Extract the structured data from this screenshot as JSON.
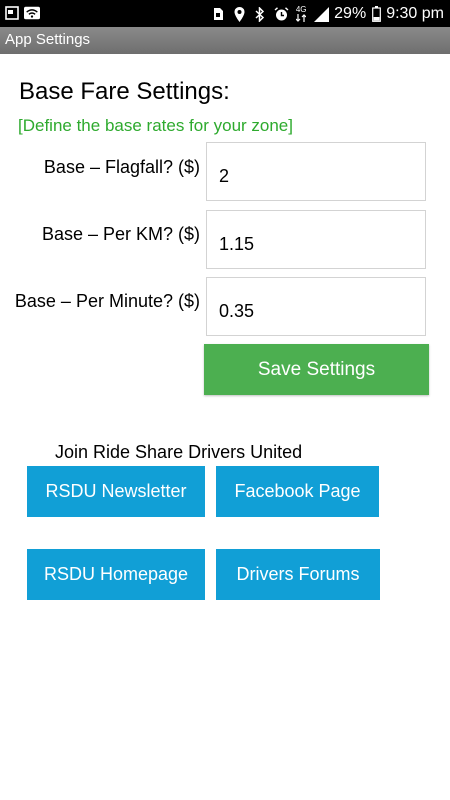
{
  "status_bar": {
    "battery_percent": "29%",
    "time": "9:30 pm",
    "network_label": "4G",
    "icons": [
      "screenshot-icon",
      "wifi-icon",
      "sim-icon",
      "location-icon",
      "bluetooth-icon",
      "alarm-icon",
      "network-icon",
      "signal-icon",
      "battery-icon"
    ]
  },
  "app_bar": {
    "title": "App Settings"
  },
  "base_fare": {
    "heading": "Base Fare Settings:",
    "subheading": "[Define the base rates for your zone]",
    "fields": [
      {
        "label": "Base – Flagfall? ($)",
        "value": "2"
      },
      {
        "label": "Base – Per KM? ($)",
        "value": "1.15"
      },
      {
        "label": "Base – Per Minute? ($)",
        "value": "0.35"
      }
    ],
    "save_label": "Save Settings"
  },
  "join": {
    "label": "Join Ride Share Drivers United",
    "buttons": [
      {
        "label": "RSDU Newsletter"
      },
      {
        "label": "Facebook Page"
      },
      {
        "label": "RSDU Homepage"
      },
      {
        "label": "Drivers Forums"
      }
    ]
  },
  "colors": {
    "status_bar_bg": "#000000",
    "app_bar_bg": "#7a7a7a",
    "subheading_text": "#2eaa2e",
    "save_button": "#4caf50",
    "link_button": "#119fd6"
  }
}
